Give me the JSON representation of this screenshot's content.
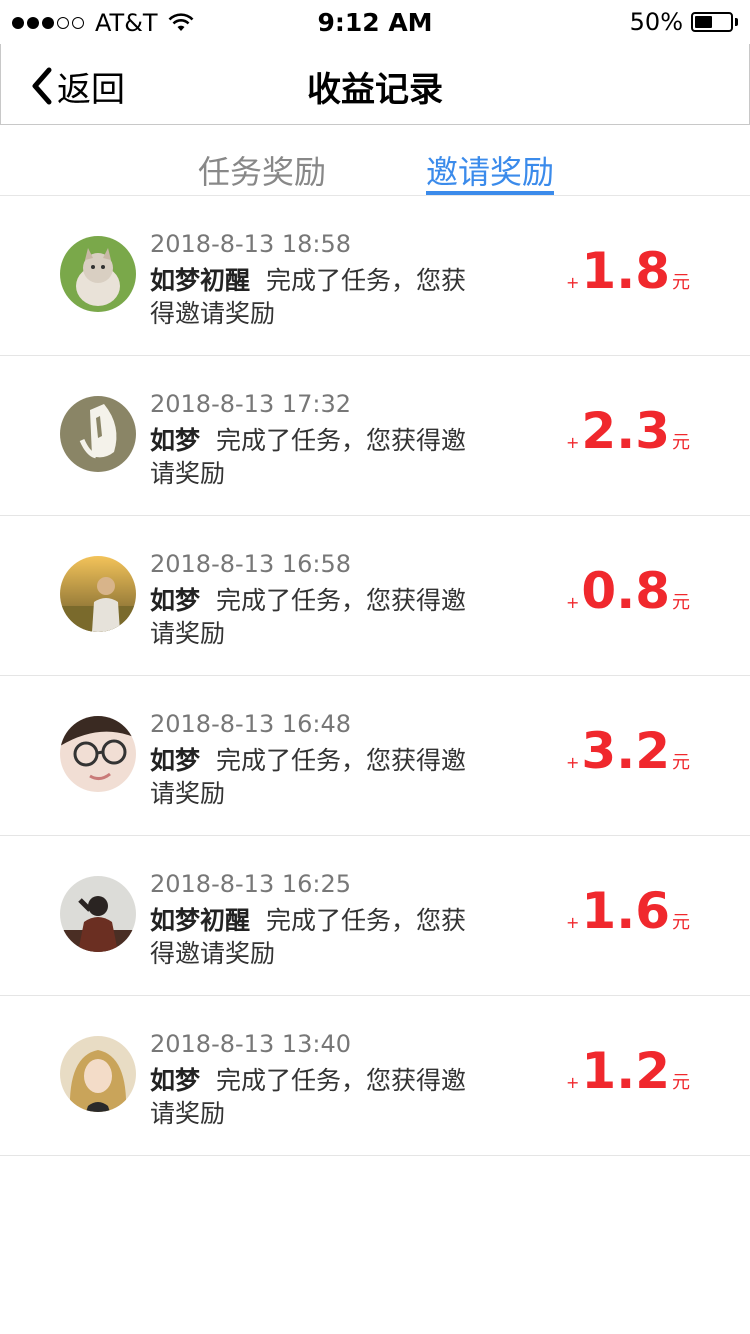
{
  "status_bar": {
    "carrier": "AT&T",
    "time": "9:12 AM",
    "battery": "50%",
    "battery_level": 0.5
  },
  "nav": {
    "back_label": "返回",
    "title": "收益记录"
  },
  "tabs": [
    {
      "label": "任务奖励",
      "active": false
    },
    {
      "label": "邀请奖励",
      "active": true
    }
  ],
  "records": [
    {
      "time": "2018-8-13 18:58",
      "name": "如梦初醒",
      "message": "完成了任务，您获得邀请奖励",
      "plus": "+",
      "amount": "1.8",
      "unit": "元"
    },
    {
      "time": "2018-8-13 17:32",
      "name": "如梦",
      "message": "完成了任务，您获得邀请奖励",
      "plus": "+",
      "amount": "2.3",
      "unit": "元"
    },
    {
      "time": "2018-8-13 16:58",
      "name": "如梦",
      "message": "完成了任务，您获得邀请奖励",
      "plus": "+",
      "amount": "0.8",
      "unit": "元"
    },
    {
      "time": "2018-8-13 16:48",
      "name": "如梦",
      "message": "完成了任务，您获得邀请奖励",
      "plus": "+",
      "amount": "3.2",
      "unit": "元"
    },
    {
      "time": "2018-8-13 16:25",
      "name": "如梦初醒",
      "message": "完成了任务，您获得邀请奖励",
      "plus": "+",
      "amount": "1.6",
      "unit": "元"
    },
    {
      "time": "2018-8-13 13:40",
      "name": "如梦",
      "message": "完成了任务，您获得邀请奖励",
      "plus": "+",
      "amount": "1.2",
      "unit": "元"
    }
  ],
  "colors": {
    "accent": "#3b8beb",
    "amount": "#f0282d",
    "inactive_tab": "#888888"
  }
}
